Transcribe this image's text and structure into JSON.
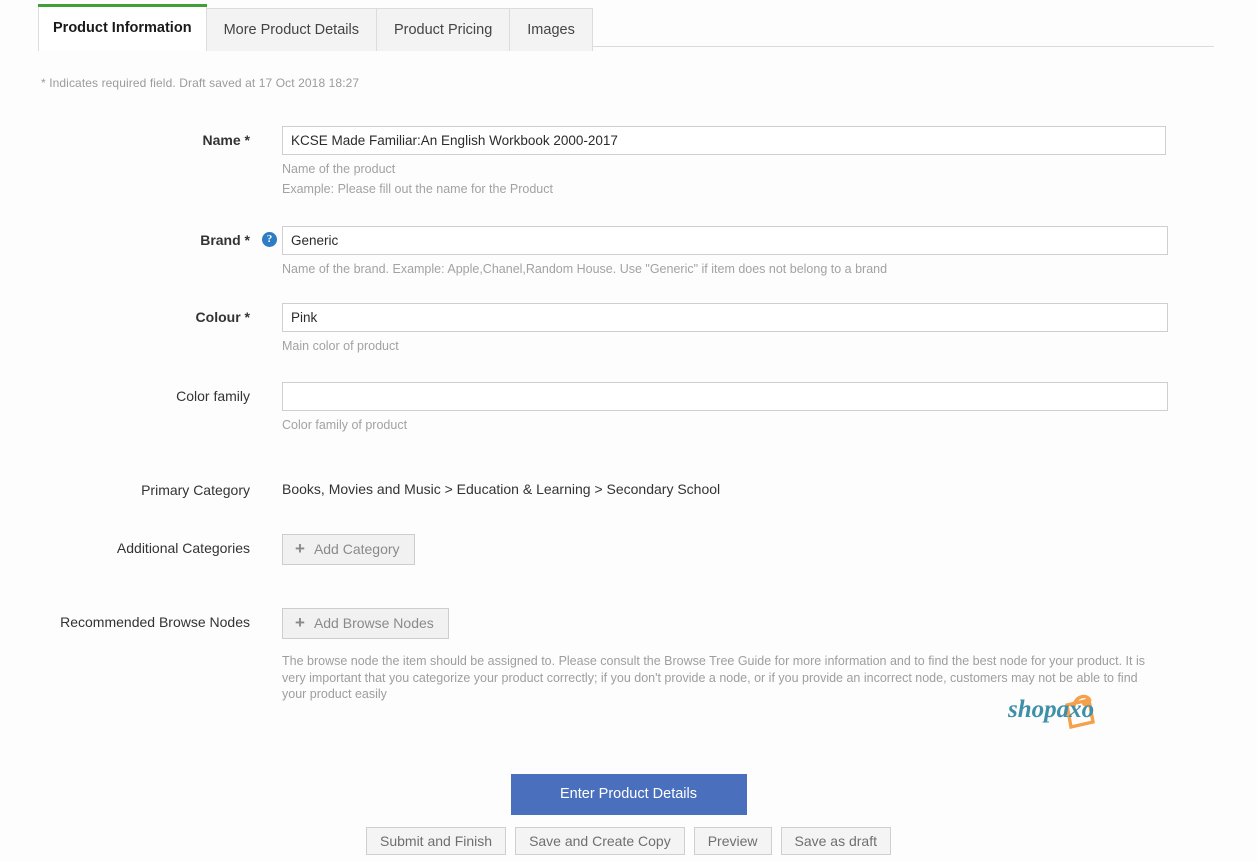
{
  "tabs": [
    {
      "label": "Product Information",
      "active": true
    },
    {
      "label": "More Product Details",
      "active": false
    },
    {
      "label": "Product Pricing",
      "active": false
    },
    {
      "label": "Images",
      "active": false
    }
  ],
  "required_note": "* Indicates required field. Draft saved at 17 Oct 2018 18:27",
  "form": {
    "name": {
      "label": "Name *",
      "value": "KCSE Made Familiar:An English Workbook 2000-2017",
      "placeholder": "",
      "hint1": "Name of the product",
      "hint2": "Example: Please fill out the name for the Product"
    },
    "brand": {
      "label": "Brand *",
      "help_icon": "question-mark-icon",
      "value": "Generic",
      "placeholder": "",
      "hint1": "Name of the brand. Example: Apple,Chanel,Random House. Use \"Generic\" if item does not belong to a brand"
    },
    "colour": {
      "label": "Colour *",
      "value": "Pink",
      "placeholder": "",
      "hint1": "Main color of product"
    },
    "color_family": {
      "label": "Color family",
      "value": "",
      "placeholder": "",
      "hint1": "Color family of product"
    },
    "primary_category": {
      "label": "Primary Category",
      "value": "Books, Movies and Music > Education & Learning > Secondary School"
    },
    "additional_categories": {
      "label": "Additional Categories",
      "button_label": "Add Category",
      "button_icon": "plus-icon"
    },
    "browse_nodes": {
      "label": "Recommended Browse Nodes",
      "button_label": "Add Browse Nodes",
      "button_icon": "plus-icon",
      "notes": "The browse node the item should be assigned to. Please consult the Browse Tree Guide for more information and to find the best node for your product. It is very important that you categorize your product correctly; if you don't provide a node, or if you provide an incorrect node, customers may not be able to find your product easily"
    }
  },
  "logo": {
    "text": "shopaxo",
    "icon": "shopping-bag-icon",
    "text_color": "#3e8fa8",
    "icon_color": "#f5a04a"
  },
  "actions": {
    "primary_label": "Enter Product Details",
    "primary_color": "#4a70bd",
    "secondary": [
      "Submit and Finish",
      "Save and Create Copy",
      "Preview",
      "Save as draft"
    ]
  },
  "theme": {
    "active_tab_accent": "#3fa037",
    "help_badge": "#2e7cc4"
  }
}
